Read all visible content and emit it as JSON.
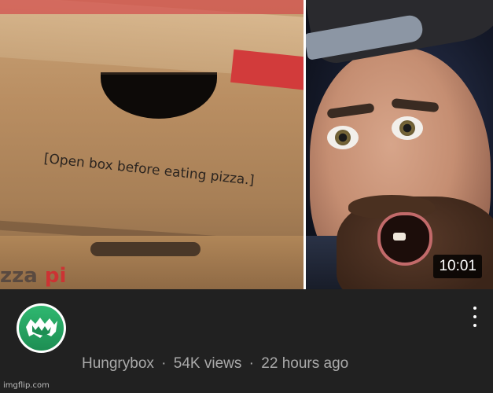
{
  "video": {
    "thumbnail_left_caption": "[Open box before eating pizza.]",
    "thumbnail_top_print": "",
    "thumbnail_bottom_print": "zza",
    "thumbnail_bottom_print_red": "pi",
    "duration": "10:01"
  },
  "channel": {
    "name": "Hungrybox",
    "views": "54K views",
    "age": "22 hours ago",
    "separator": "·"
  },
  "icons": {
    "avatar": "channel-avatar-icon",
    "menu": "more-vert-icon"
  },
  "colors": {
    "background": "#212121",
    "meta_text": "#aaaaaa",
    "avatar_green": "#2fb870"
  },
  "watermark": "imgflip.com"
}
